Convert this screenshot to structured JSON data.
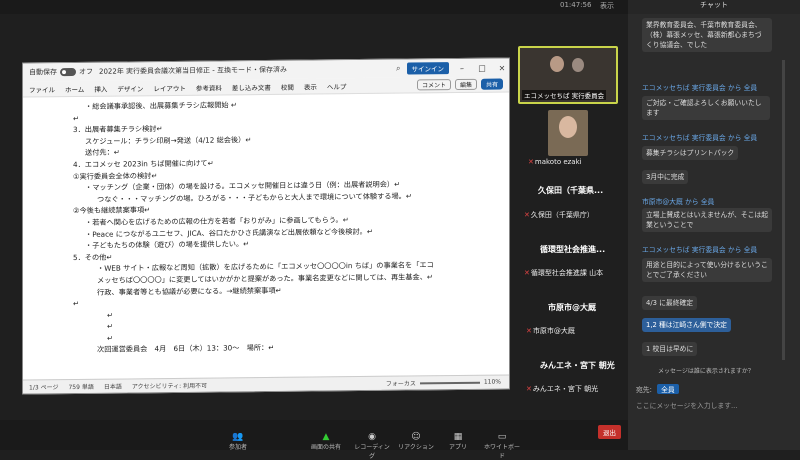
{
  "zoom": {
    "clock": "01:47:56",
    "view_label": "表示"
  },
  "word": {
    "autosave": "自動保存",
    "autosave_state": "オフ",
    "doc_title": "2022年 実行委員会議次第当日修正 - 互換モード・保存済み",
    "signin": "サインイン",
    "tabs": [
      "ファイル",
      "ホーム",
      "挿入",
      "デザイン",
      "レイアウト",
      "参考資料",
      "差し込み文書",
      "校閲",
      "表示",
      "ヘルプ"
    ],
    "comment_btn": "コメント",
    "edit_btn": "編集",
    "share_btn": "共有",
    "lines": [
      {
        "indent": "i1",
        "text": "・総会議事承認後、出展募集チラシ広報開始 ↵"
      },
      {
        "indent": "",
        "text": "↵"
      },
      {
        "indent": "",
        "text": "3．出展者募集チラシ検討↵"
      },
      {
        "indent": "i1",
        "text": "スケジュール：チラシ印刷→発送（4/12 総会後）↵"
      },
      {
        "indent": "i1",
        "text": "送付先：↵"
      },
      {
        "indent": "",
        "text": "4．エコメッセ 2023in ちば開催に向けて↵"
      },
      {
        "indent": "",
        "text": "①実行委員会全体の検討↵"
      },
      {
        "indent": "i1",
        "text": "・マッチング（企業・団体）の場を設ける。エコメッセ開催日とは違う日（例：出展者説明会）↵"
      },
      {
        "indent": "i2",
        "text": "つなぐ・・・マッチングの場。ひろがる・・・子どもからと大人まで環境について体験する場。↵"
      },
      {
        "indent": "",
        "text": "②今後も継続禁案事項↵"
      },
      {
        "indent": "i1",
        "text": "・若者へ関心を広げるための広報の仕方を若者「おりがみ」に参画してもらう。↵"
      },
      {
        "indent": "i1",
        "text": "・Peace につながるユニセフ、JICA、谷口たかひさ氏講演など出展依頼など今後検討。↵"
      },
      {
        "indent": "i1",
        "text": "・子どもたちの体験（遊び）の場を提供したい。↵"
      },
      {
        "indent": "",
        "text": "5．その他↵"
      },
      {
        "indent": "i2",
        "text": "・WEB サイト・広報など周知（拡散）を広げるために「エコメッセ〇〇〇〇in ちば」の事業名を「エコ"
      },
      {
        "indent": "i2",
        "text": "メッセちば〇〇〇〇」に変更してはいかがかと提案があった。事業名変更などに関しては、再生基金、↵"
      },
      {
        "indent": "i2",
        "text": "行政、事業者等とも協議が必要になる。→継続禁案事項↵"
      },
      {
        "indent": "",
        "text": "↵"
      },
      {
        "indent": "i3",
        "text": "↵"
      },
      {
        "indent": "i3",
        "text": "↵"
      },
      {
        "indent": "i3",
        "text": "↵"
      },
      {
        "indent": "i2",
        "text": "次回運営委員会　4月　6日（木）13：30～　場所：↵"
      }
    ],
    "status": {
      "page": "1/3 ページ",
      "words": "759 単語",
      "lang": "日本語",
      "accessibility": "アクセシビリティ: 利用不可",
      "focus": "フォーカス",
      "zoom": "110%"
    }
  },
  "gallery": {
    "tile1_name": "エコメッセちば 実行委員会",
    "tile2_name": "makoto ezaki",
    "participants": [
      {
        "big": "久保田（千葉県...",
        "small": "久保田（千葉県庁）"
      },
      {
        "big": "循環型社会推進...",
        "small": "循環型社会推進課 山本"
      },
      {
        "big": "市原市@大厩",
        "small": "市原市@大厩"
      },
      {
        "big": "みんエネ・宮下 朝光",
        "small": "みんエネ・宮下 朝光"
      }
    ]
  },
  "chat": {
    "title": "チャット",
    "msg1": "業界教育委員会、千葉市教育委員会、（株）幕張メッセ、幕張新都心まちづくり協議会、でした",
    "head1": "エコメッセちば 実行委員会 から 全員",
    "msg2": "ご対応・ご確認よろしくお願いいたします",
    "head2": "エコメッセちば 実行委員会 から 全員",
    "msg3": "募集チラシはプリントパック",
    "msg4": "3月中に完成",
    "head3": "市原市@大厩 から 全員",
    "msg5": "立場上賛成とはいえませんが、そこは起業ということで",
    "head4": "エコメッセちば 実行委員会 から 全員",
    "msg6": "用途と目的によって使い分けるということでご了承ください",
    "msg7": "4/3 に最終確定",
    "msg8": "1,2 種は江崎さん側で決定",
    "msg9": "1 校目は早めに",
    "notice": "メッセージは誰に表示されますか？",
    "to_label": "宛先:",
    "to_value": "全員",
    "placeholder": "ここにメッセージを入力します..."
  },
  "toolbar": {
    "buttons": [
      "参加者",
      "画面の共有",
      "レコーディング",
      "リアクション",
      "アプリ",
      "ホワイトボード"
    ],
    "leave": "退出"
  }
}
